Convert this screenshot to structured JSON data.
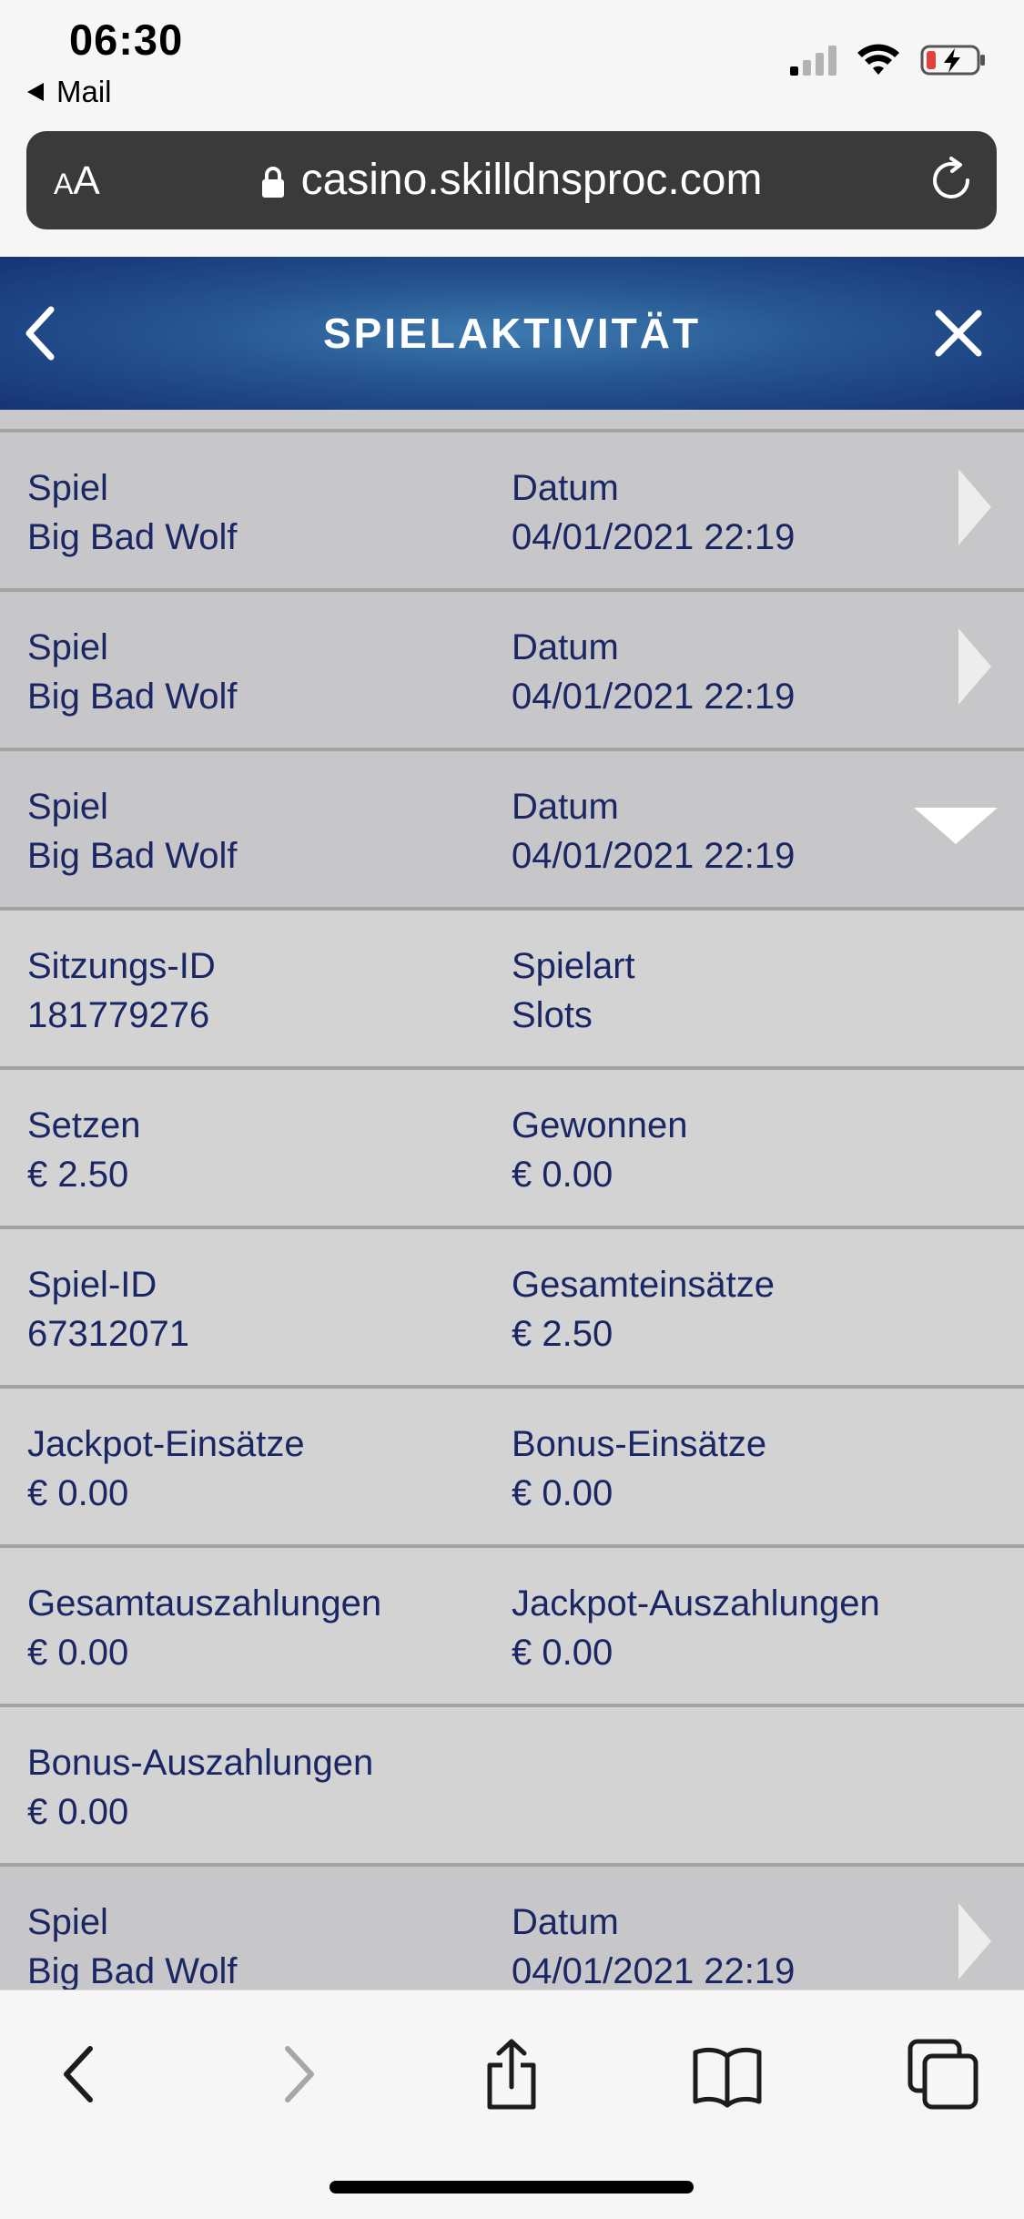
{
  "status_bar": {
    "time": "06:30",
    "back_app": "Mail"
  },
  "browser": {
    "text_size_label_small": "A",
    "text_size_label_large": "A",
    "url": "casino.skilldnsproc.com"
  },
  "header": {
    "title": "SPIELAKTIVITÄT"
  },
  "rows": [
    {
      "kind": "summary",
      "expanded": false,
      "left_label": "Spiel",
      "left_value": "Big Bad Wolf",
      "right_label": "Datum",
      "right_value": "04/01/2021 22:19"
    },
    {
      "kind": "summary",
      "expanded": false,
      "left_label": "Spiel",
      "left_value": "Big Bad Wolf",
      "right_label": "Datum",
      "right_value": "04/01/2021 22:19"
    },
    {
      "kind": "summary",
      "expanded": true,
      "left_label": "Spiel",
      "left_value": "Big Bad Wolf",
      "right_label": "Datum",
      "right_value": "04/01/2021 22:19"
    },
    {
      "kind": "detail",
      "left_label": "Sitzungs-ID",
      "left_value": "181779276",
      "right_label": "Spielart",
      "right_value": "Slots"
    },
    {
      "kind": "detail",
      "left_label": "Setzen",
      "left_value": "€ 2.50",
      "right_label": "Gewonnen",
      "right_value": "€ 0.00"
    },
    {
      "kind": "detail",
      "left_label": "Spiel-ID",
      "left_value": "67312071",
      "right_label": "Gesamteinsätze",
      "right_value": "€ 2.50"
    },
    {
      "kind": "detail",
      "left_label": "Jackpot-Einsätze",
      "left_value": "€ 0.00",
      "right_label": "Bonus-Einsätze",
      "right_value": "€ 0.00"
    },
    {
      "kind": "detail",
      "left_label": "Gesamtauszahlungen",
      "left_value": "€ 0.00",
      "right_label": "Jackpot-Auszahlungen",
      "right_value": "€ 0.00"
    },
    {
      "kind": "detail",
      "left_label": "Bonus-Auszahlungen",
      "left_value": "€ 0.00",
      "right_label": "",
      "right_value": ""
    },
    {
      "kind": "summary",
      "expanded": false,
      "left_label": "Spiel",
      "left_value": "Big Bad Wolf",
      "right_label": "Datum",
      "right_value": "04/01/2021 22:19"
    }
  ],
  "icons": {
    "status": [
      "signal-icon",
      "wifi-icon",
      "battery-charging-icon"
    ],
    "browser": [
      "lock-icon",
      "reload-icon"
    ],
    "header": [
      "chevron-left-icon",
      "close-icon"
    ],
    "row": [
      "chevron-right-icon",
      "chevron-down-icon"
    ],
    "toolbar": [
      "back-icon",
      "forward-icon",
      "share-icon",
      "bookmarks-icon",
      "tabs-icon"
    ]
  },
  "colors": {
    "header_blue": "#26558f",
    "text_navy": "#1b2765",
    "row_bg": "#d3d3d3",
    "battery_low": "#e0433b"
  },
  "signal_bars_active": 1
}
